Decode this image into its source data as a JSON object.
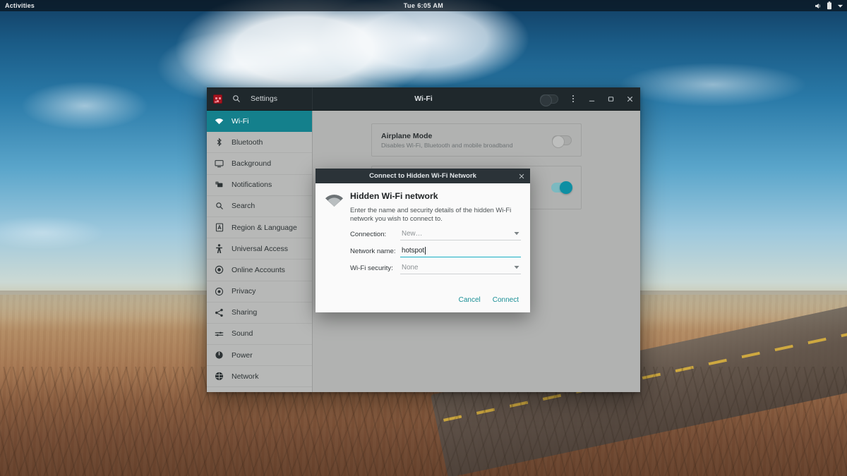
{
  "topbar": {
    "activities": "Activities",
    "clock": "Tue  6:05 AM",
    "tray_icons": [
      "volume-icon",
      "battery-icon",
      "chevron-down-icon"
    ]
  },
  "window": {
    "app_name": "Settings",
    "app_icon": "settings-app-icon",
    "search_icon": "search-icon",
    "title": "Wi-Fi",
    "header_switch_state": "off",
    "menu_icon": "kebab-menu-icon",
    "minimize_label": "—",
    "maximize_label": "□",
    "close_label": "✕"
  },
  "sidebar": {
    "items": [
      {
        "label": "Wi-Fi",
        "icon": "wifi-icon",
        "selected": true
      },
      {
        "label": "Bluetooth",
        "icon": "bluetooth-icon",
        "selected": false
      },
      {
        "label": "Background",
        "icon": "monitor-icon",
        "selected": false
      },
      {
        "label": "Notifications",
        "icon": "notification-icon",
        "selected": false
      },
      {
        "label": "Search",
        "icon": "search-icon",
        "selected": false
      },
      {
        "label": "Region & Language",
        "icon": "region-language-icon",
        "selected": false
      },
      {
        "label": "Universal Access",
        "icon": "universal-access-icon",
        "selected": false
      },
      {
        "label": "Online Accounts",
        "icon": "online-accounts-icon",
        "selected": false
      },
      {
        "label": "Privacy",
        "icon": "privacy-icon",
        "selected": false
      },
      {
        "label": "Sharing",
        "icon": "sharing-icon",
        "selected": false
      },
      {
        "label": "Sound",
        "icon": "sound-icon",
        "selected": false
      },
      {
        "label": "Power",
        "icon": "power-icon",
        "selected": false
      },
      {
        "label": "Network",
        "icon": "network-icon",
        "selected": false
      }
    ]
  },
  "content": {
    "airplane": {
      "title": "Airplane Mode",
      "subtitle": "Disables Wi-Fi, Bluetooth and mobile broadband",
      "switch_state": "off"
    },
    "wifi_panel": {
      "switch_state": "on"
    }
  },
  "dialog": {
    "title": "Connect to Hidden Wi-Fi Network",
    "close_label": "✕",
    "icon": "wifi-icon",
    "heading": "Hidden Wi-Fi network",
    "description": "Enter the name and security details of the hidden Wi-Fi network you wish to connect to.",
    "fields": [
      {
        "label": "Connection:",
        "value": "New…",
        "type": "dropdown",
        "focused": false
      },
      {
        "label": "Network name:",
        "value": "hotspot",
        "type": "text",
        "focused": true
      },
      {
        "label": "Wi-Fi security:",
        "value": "None",
        "type": "dropdown",
        "focused": false
      }
    ],
    "cancel_label": "Cancel",
    "connect_label": "Connect"
  },
  "colors": {
    "accent_teal": "#14808c",
    "focus_underline": "#16b0c4",
    "switch_on": "#0e8fa3",
    "titlebar": "#2b3338",
    "sidebar_bg": "#b7b8b7"
  }
}
